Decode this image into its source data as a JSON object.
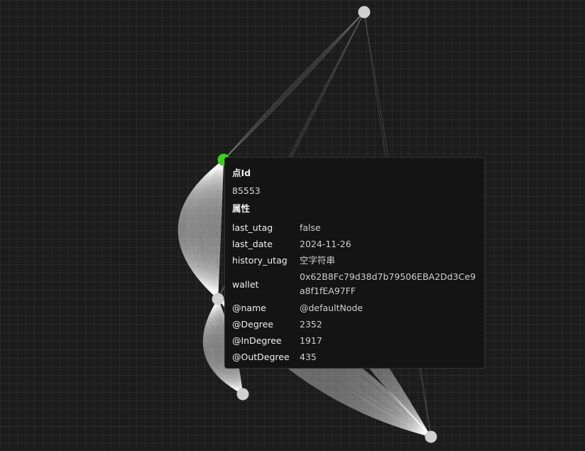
{
  "colors": {
    "background": "#1c1c1c",
    "node": "#cfcfcf",
    "selected_node": "#39d41a",
    "edge": "#ffffff",
    "tooltip_bg": "#141414"
  },
  "tooltip": {
    "id_label": "点Id",
    "id_value": "85553",
    "props_label": "属性",
    "properties": [
      {
        "key": "last_utag",
        "value": "false"
      },
      {
        "key": "last_date",
        "value": "2024-11-26"
      },
      {
        "key": "history_utag",
        "value": "空字符串"
      },
      {
        "key": "wallet",
        "value": "0x62B8Fc79d38d7b79506EBA2Dd3Ce9a8f1fEA97FF"
      },
      {
        "key": "@name",
        "value": "@defaultNode"
      },
      {
        "key": "@Degree",
        "value": "2352"
      },
      {
        "key": "@InDegree",
        "value": "1917"
      },
      {
        "key": "@OutDegree",
        "value": "435"
      }
    ]
  }
}
